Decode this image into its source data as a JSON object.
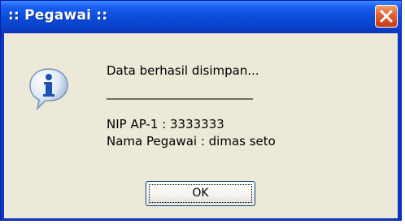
{
  "dialog": {
    "title": ":: Pegawai ::",
    "message_lines": [
      "Data berhasil disimpan...",
      "________________________",
      "NIP AP-1 : 3333333",
      "Nama Pegawai : dimas seto"
    ],
    "ok_label": "OK",
    "icon": "info-icon",
    "close_icon": "close-icon"
  },
  "colors": {
    "titlebar": "#0b4ad8",
    "client": "#ece9d8",
    "close": "#e2602e"
  }
}
